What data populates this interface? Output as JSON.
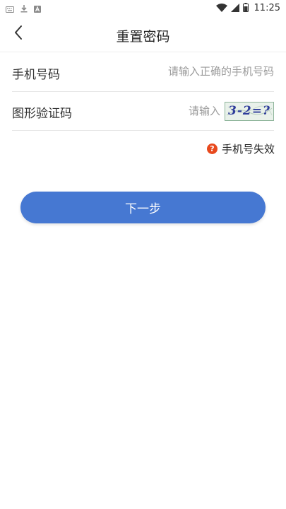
{
  "status_bar": {
    "time": "11:25"
  },
  "header": {
    "title": "重置密码",
    "back_icon": "chevron-left-icon"
  },
  "form": {
    "phone": {
      "label": "手机号码",
      "value": "",
      "placeholder": "请输入正确的手机号码"
    },
    "captcha": {
      "label": "图形验证码",
      "value": "",
      "placeholder": "请输入",
      "image_text": "3-2=?"
    }
  },
  "help": {
    "icon": "question-circle-icon",
    "label": "手机号失效",
    "icon_color": "#e8491d"
  },
  "next_button": {
    "label": "下一步",
    "color": "#4678d2"
  }
}
